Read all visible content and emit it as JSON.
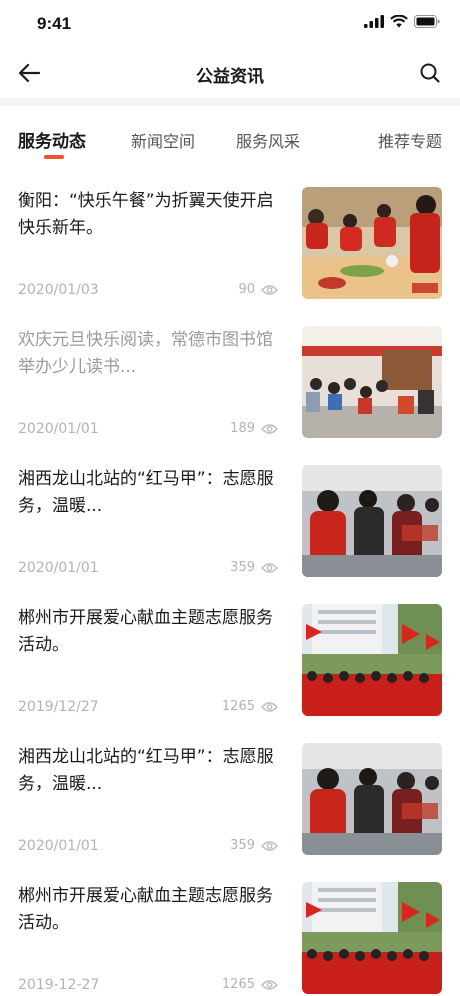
{
  "status": {
    "time": "9:41"
  },
  "nav": {
    "title": "公益资讯"
  },
  "tabs": [
    {
      "label": "服务动态"
    },
    {
      "label": "新闻空间"
    },
    {
      "label": "服务风采"
    },
    {
      "label": "推荐专题"
    }
  ],
  "articles": [
    {
      "title": "衡阳：“快乐午餐”为折翼天使开启快乐新年。",
      "date": "2020/01/03",
      "views": "90",
      "read": false
    },
    {
      "title": "欢庆元旦快乐阅读，常德市图书馆举办少儿读书...",
      "date": "2020/01/01",
      "views": "189",
      "read": true
    },
    {
      "title": "湘西龙山北站的“红马甲”：志愿服务，温暖...",
      "date": "2020/01/01",
      "views": "359",
      "read": false
    },
    {
      "title": "郴州市开展爱心献血主题志愿服务活动。",
      "date": "2019/12/27",
      "views": "1265",
      "read": false
    },
    {
      "title": "湘西龙山北站的“红马甲”：志愿服务，温暖...",
      "date": "2020/01/01",
      "views": "359",
      "read": false
    },
    {
      "title": "郴州市开展爱心献血主题志愿服务活动。",
      "date": "2019-12-27",
      "views": "1265",
      "read": false
    }
  ],
  "colors": {
    "accent": "#f0512e",
    "read_title": "#9a9a9a",
    "meta": "#b3b3b3"
  },
  "icons": {
    "back": "arrow-left-icon",
    "search": "search-icon",
    "views": "eye-icon"
  }
}
